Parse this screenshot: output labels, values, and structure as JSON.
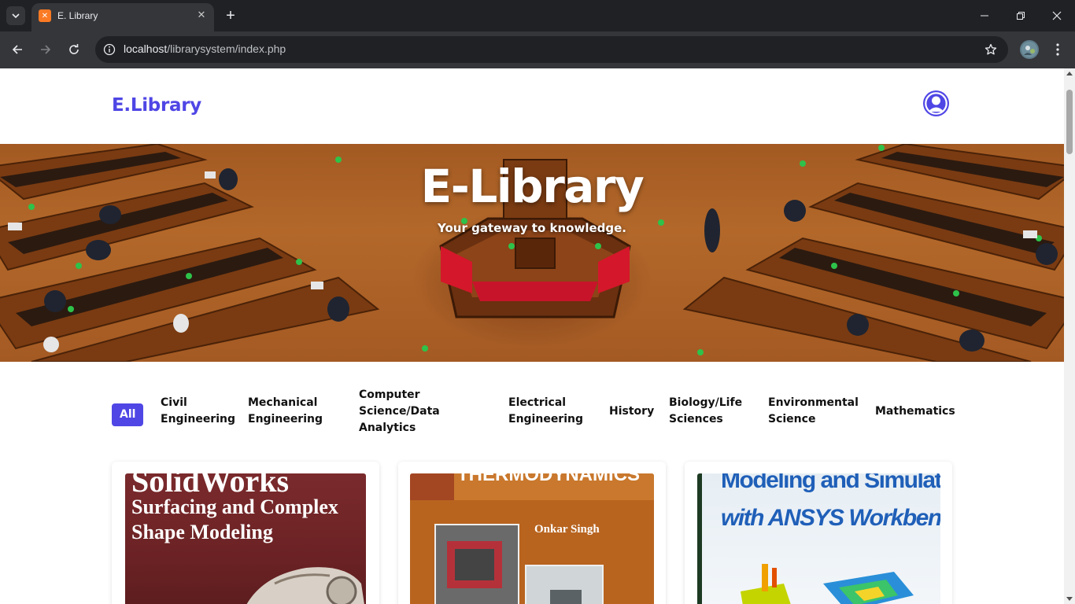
{
  "browser": {
    "tab_title": "E. Library",
    "url_host": "localhost",
    "url_path": "/librarysystem/index.php"
  },
  "site": {
    "logo": "E.Library"
  },
  "hero": {
    "title": "E-Library",
    "subtitle": "Your gateway to knowledge."
  },
  "filters": [
    {
      "label": "All"
    },
    {
      "label": "Civil Engineering"
    },
    {
      "label": "Mechanical Engineering"
    },
    {
      "label": "Computer Science/Data Analytics"
    },
    {
      "label": "Electrical Engineering"
    },
    {
      "label": "History"
    },
    {
      "label": "Biology/Life Sciences"
    },
    {
      "label": "Environmental Science"
    },
    {
      "label": "Mathematics"
    }
  ],
  "books": [
    {
      "cover_line1": "SolidWorks",
      "cover_line2": "Surfacing and Complex",
      "cover_line3": "Shape Modeling"
    },
    {
      "cover_line1": "THERMODYNAMICS",
      "cover_author": "Onkar Singh"
    },
    {
      "cover_line1": "Modeling and Simulation",
      "cover_line2": "with ANSYS Workbench"
    }
  ],
  "colors": {
    "accent": "#4f46e5"
  }
}
